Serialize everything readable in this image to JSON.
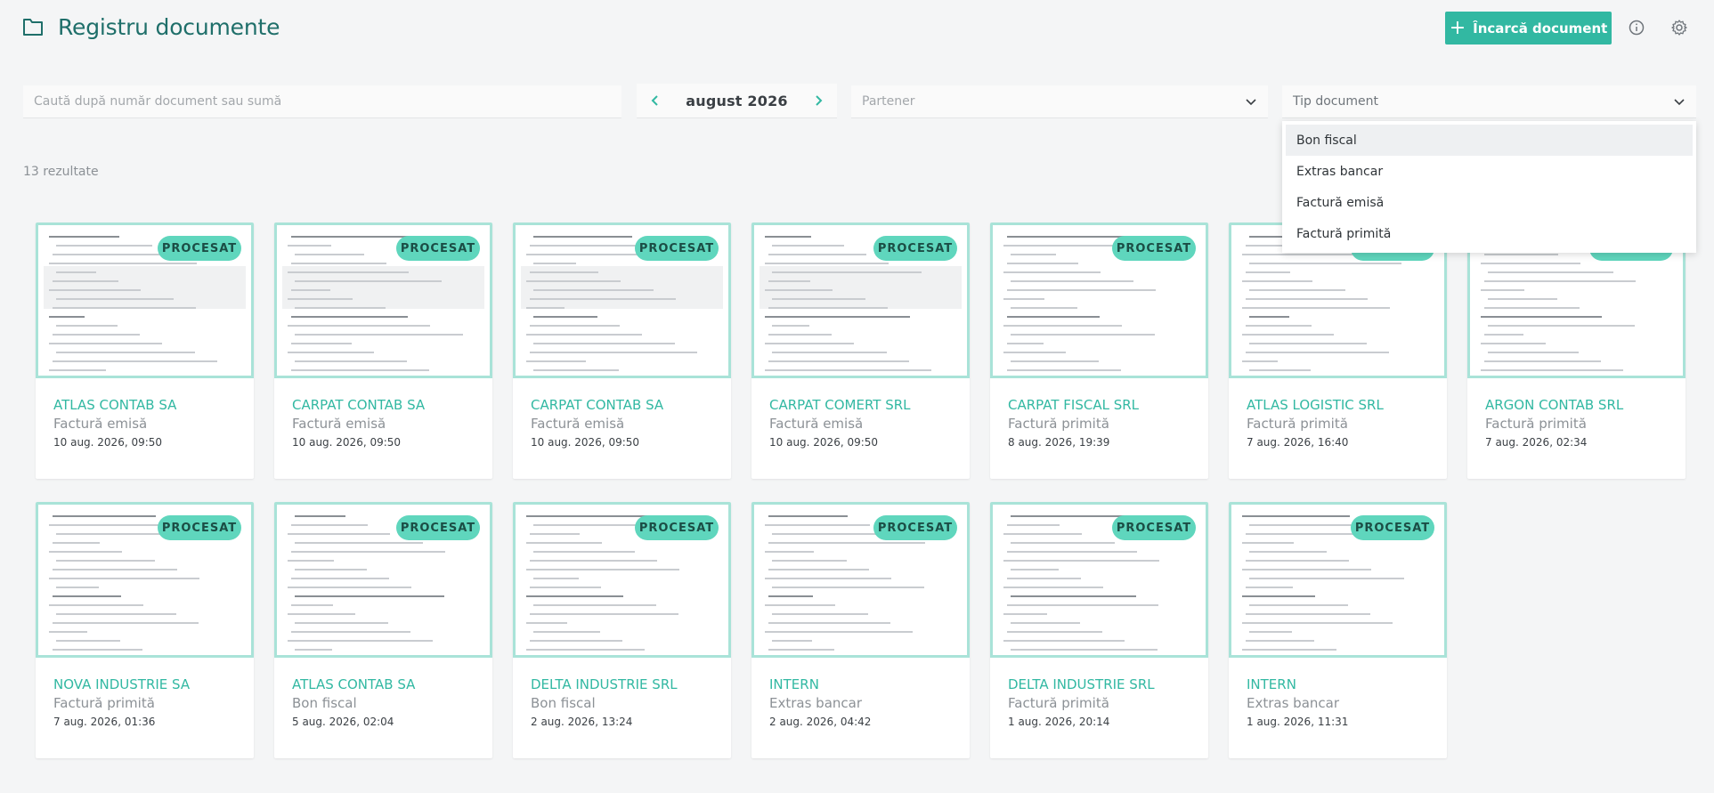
{
  "header": {
    "title": "Registru documente",
    "upload_label": "Încarcă document",
    "icons": [
      "folder-icon",
      "plus-icon",
      "info-icon",
      "gear-icon"
    ]
  },
  "filters": {
    "search_placeholder": "Caută după număr document sau sumă",
    "month": "august 2026",
    "partner_placeholder": "Partener",
    "doc_type_placeholder": "Tip document"
  },
  "dropdown": {
    "options": [
      "Bon fiscal",
      "Extras bancar",
      "Factură emisă",
      "Factură primită"
    ]
  },
  "results": {
    "count_text": "13 rezultate"
  },
  "colors": {
    "accent": "#32b8a2",
    "title": "#1f6f6a",
    "badge": "#5fd6bd"
  },
  "cards": [
    {
      "partner": "ATLAS CONTAB SA",
      "type": "Factură emisă",
      "date": "10 aug. 2026, 09:50",
      "status": "PROCESAT"
    },
    {
      "partner": "CARPAT CONTAB SA",
      "type": "Factură emisă",
      "date": "10 aug. 2026, 09:50",
      "status": "PROCESAT"
    },
    {
      "partner": "CARPAT CONTAB SA",
      "type": "Factură emisă",
      "date": "10 aug. 2026, 09:50",
      "status": "PROCESAT"
    },
    {
      "partner": "CARPAT COMERT SRL",
      "type": "Factură emisă",
      "date": "10 aug. 2026, 09:50",
      "status": "PROCESAT"
    },
    {
      "partner": "CARPAT FISCAL SRL",
      "type": "Factură primită",
      "date": "8 aug. 2026, 19:39",
      "status": "PROCESAT"
    },
    {
      "partner": "ATLAS LOGISTIC SRL",
      "type": "Factură primită",
      "date": "7 aug. 2026, 16:40",
      "status": "PROCESAT"
    },
    {
      "partner": "ARGON CONTAB SRL",
      "type": "Factură primită",
      "date": "7 aug. 2026, 02:34",
      "status": "PROCESAT"
    },
    {
      "partner": "NOVA INDUSTRIE SA",
      "type": "Factură primită",
      "date": "7 aug. 2026, 01:36",
      "status": "PROCESAT"
    },
    {
      "partner": "ATLAS CONTAB SA",
      "type": "Bon fiscal",
      "date": "5 aug. 2026, 02:04",
      "status": "PROCESAT"
    },
    {
      "partner": "DELTA INDUSTRIE SRL",
      "type": "Bon fiscal",
      "date": "2 aug. 2026, 13:24",
      "status": "PROCESAT"
    },
    {
      "partner": "INTERN",
      "type": "Extras bancar",
      "date": "2 aug. 2026, 04:42",
      "status": "PROCESAT"
    },
    {
      "partner": "DELTA INDUSTRIE SRL",
      "type": "Factură primită",
      "date": "1 aug. 2026, 20:14",
      "status": "PROCESAT"
    },
    {
      "partner": "INTERN",
      "type": "Extras bancar",
      "date": "1 aug. 2026, 11:31",
      "status": "PROCESAT"
    }
  ]
}
